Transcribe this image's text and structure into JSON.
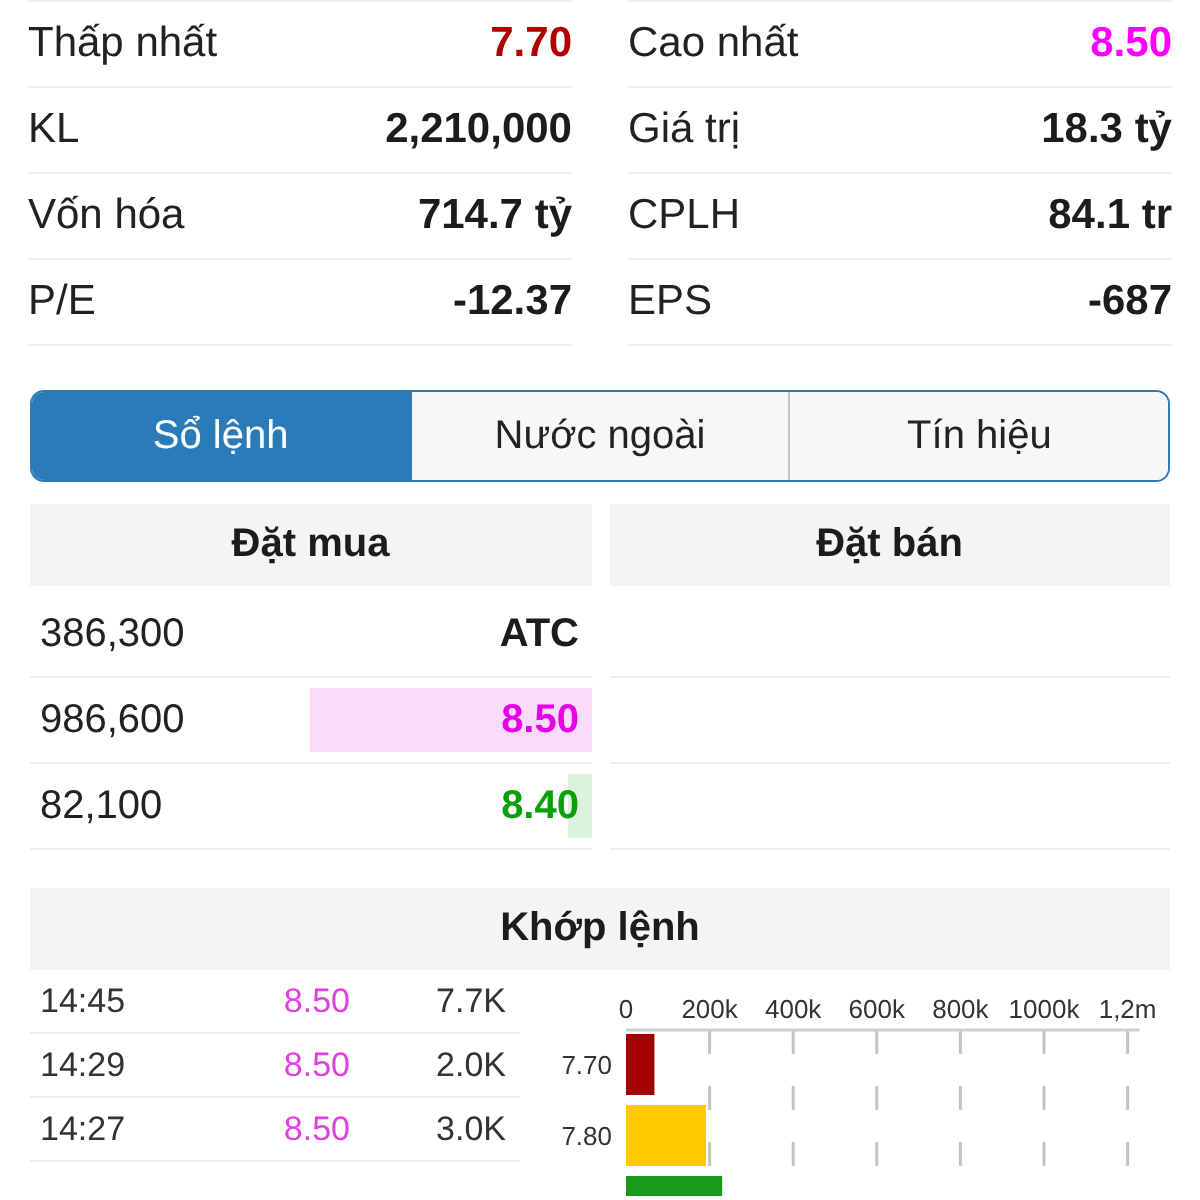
{
  "stats": [
    {
      "label": "Thấp nhất",
      "value": "7.70",
      "color": "#b00000"
    },
    {
      "label": "Cao nhất",
      "value": "8.50",
      "color": "#ff00ff"
    },
    {
      "label": "KL",
      "value": "2,210,000",
      "color": "#1c1c1c"
    },
    {
      "label": "Giá trị",
      "value": "18.3 tỷ",
      "color": "#1c1c1c"
    },
    {
      "label": "Vốn hóa",
      "value": "714.7 tỷ",
      "color": "#1c1c1c"
    },
    {
      "label": "CPLH",
      "value": "84.1 tr",
      "color": "#1c1c1c"
    },
    {
      "label": "P/E",
      "value": "-12.37",
      "color": "#1c1c1c"
    },
    {
      "label": "EPS",
      "value": "-687",
      "color": "#1c1c1c"
    }
  ],
  "tabs": [
    {
      "label": "Sổ lệnh",
      "selected": true
    },
    {
      "label": "Nước ngoài",
      "selected": false
    },
    {
      "label": "Tín hiệu",
      "selected": false
    }
  ],
  "order_book": {
    "headers": [
      "Đặt mua",
      "Đặt bán"
    ],
    "bids": [
      {
        "volume": "386,300",
        "price": "ATC",
        "color": "#1c1c1c"
      },
      {
        "volume": "986,600",
        "price": "8.50",
        "color": "#e600e6",
        "level": 0.5
      },
      {
        "volume": "82,100",
        "price": "8.40",
        "color": "#0aa00a",
        "level": 0.04
      }
    ]
  },
  "matched": {
    "title": "Khớp lệnh",
    "trades": [
      {
        "time": "14:45",
        "price": "8.50",
        "volume": "7.7K",
        "color": "#e040e0"
      },
      {
        "time": "14:29",
        "price": "8.50",
        "volume": "2.0K",
        "color": "#e040e0"
      },
      {
        "time": "14:27",
        "price": "8.50",
        "volume": "3.0K",
        "color": "#e040e0"
      }
    ],
    "chart_data": {
      "type": "bar",
      "orientation": "horizontal",
      "grid": true,
      "categories": [
        "7.70",
        "7.80",
        null
      ],
      "values": [
        68000,
        191000,
        230000
      ],
      "colors": [
        "#a50000",
        "#ffc800",
        "#1a9a1a"
      ],
      "xlim": [
        0,
        1200000
      ],
      "xticks": [
        0,
        {
          "value": 200000,
          "label": "200k"
        },
        {
          "value": 400000,
          "label": "400k"
        },
        {
          "value": 600000,
          "label": "600k"
        },
        {
          "value": 800000,
          "label": "800k"
        },
        {
          "value": 1000000,
          "label": "1000k"
        },
        {
          "value": 1200000,
          "label": "1,2m"
        }
      ]
    }
  }
}
